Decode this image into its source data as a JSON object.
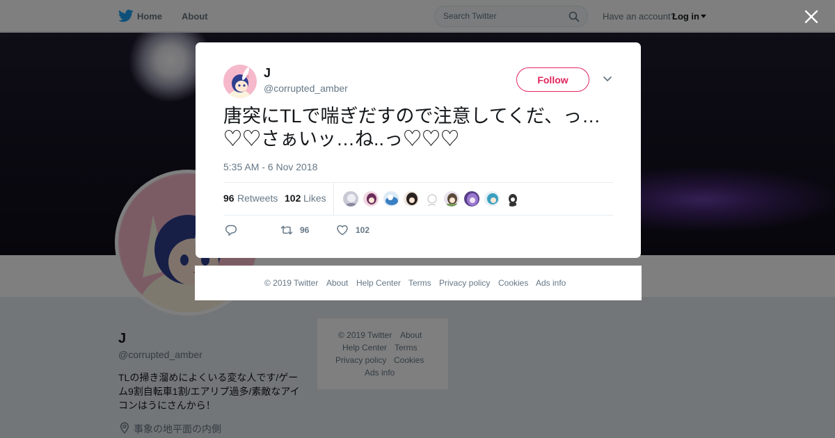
{
  "nav": {
    "home": "Home",
    "about": "About",
    "search_placeholder": "Search Twitter",
    "have_account": "Have an account?",
    "login": "Log in"
  },
  "profile": {
    "name": "J",
    "handle": "@corrupted_amber",
    "bio": "TLの掃き溜めによくいる変な人です/ゲーム9割自転車1割/エアリプ過多/素敵なアイコンはうにさんから！",
    "location": "事象の地平面の内側"
  },
  "side_footer": {
    "copyright": "© 2019 Twitter",
    "about": "About",
    "help": "Help Center",
    "terms": "Terms",
    "privacy": "Privacy policy",
    "cookies": "Cookies",
    "ads": "Ads info"
  },
  "tweet": {
    "name": "J",
    "handle": "@corrupted_amber",
    "follow_label": "Follow",
    "text": "唐突にTLで喘ぎだすので注意してくだ、っ…♡♡さぁいッ…ね..っ♡♡♡",
    "time": "5:35 AM - 6 Nov 2018",
    "retweets": "96",
    "retweets_label": "Retweets",
    "likes": "102",
    "likes_label": "Likes",
    "action_retweets": "96",
    "action_likes": "102"
  },
  "modal_footer": {
    "copyright": "© 2019 Twitter",
    "about": "About",
    "help": "Help Center",
    "terms": "Terms",
    "privacy": "Privacy policy",
    "cookies": "Cookies",
    "ads": "Ads info"
  },
  "colors": {
    "accent": "#1da1f2",
    "like": "#e0245e",
    "muted": "#657786"
  },
  "icons": [
    "twitter-bird-icon",
    "search-icon",
    "close-icon",
    "chevron-down-icon",
    "reply-icon",
    "retweet-icon",
    "heart-icon",
    "location-icon"
  ]
}
